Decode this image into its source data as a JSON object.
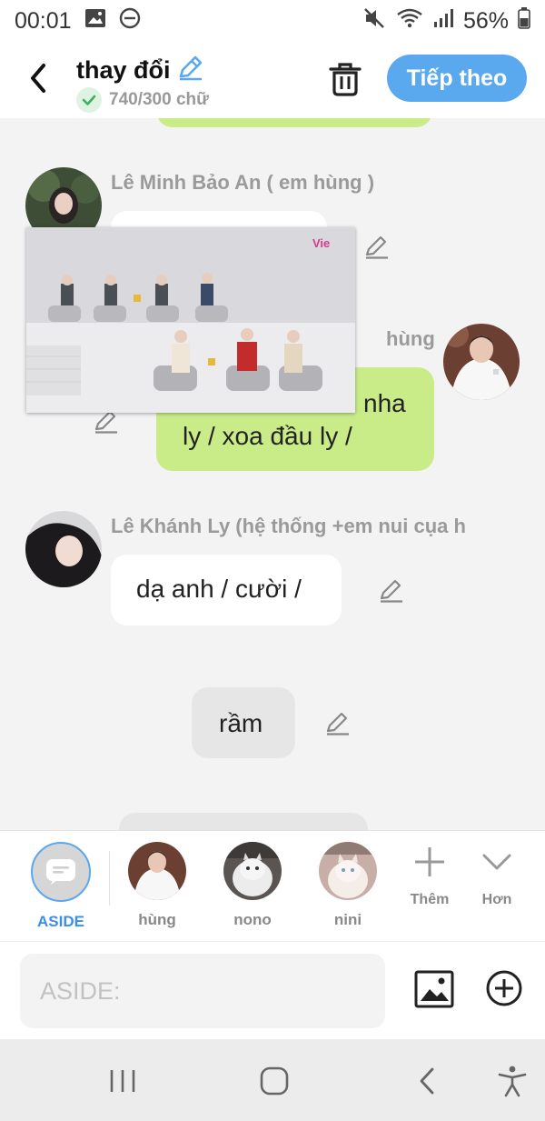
{
  "status_bar": {
    "time": "00:01",
    "battery": "56%",
    "left_icons": [
      "image-icon",
      "do-not-disturb-icon"
    ],
    "right_icons": [
      "mute-icon",
      "wifi-icon",
      "signal-icon",
      "battery-icon"
    ]
  },
  "header": {
    "title": "thay đổi",
    "char_count": "740/300 chữ",
    "next_label": "Tiếp theo"
  },
  "chat": {
    "partial_top_bubble_color": "#c9ec88",
    "messages": [
      {
        "sender": "Lê Minh Bảo An ( em hùng )"
      },
      {
        "sender": "hùng",
        "text": "… nhỉ, anh ơi nha ly / xoa đầu ly /",
        "line1_visible": "nha",
        "line2": "ly / xoa đầu ly /"
      },
      {
        "sender": "Lê Khánh Ly (hệ thống +em nui cụa h",
        "text": "dạ anh / cười /"
      },
      {
        "text": "rầm"
      }
    ],
    "video_logo": "Vie"
  },
  "characters": {
    "items": [
      {
        "label": "ASIDE"
      },
      {
        "label": "hùng"
      },
      {
        "label": "nono"
      },
      {
        "label": "nini"
      }
    ],
    "add_label": "Thêm",
    "more_label": "Hơn"
  },
  "input": {
    "placeholder": "ASIDE:"
  },
  "colors": {
    "accent": "#5aa8ee",
    "green_bubble": "#c9ec88",
    "background": "#f3f3f3"
  }
}
